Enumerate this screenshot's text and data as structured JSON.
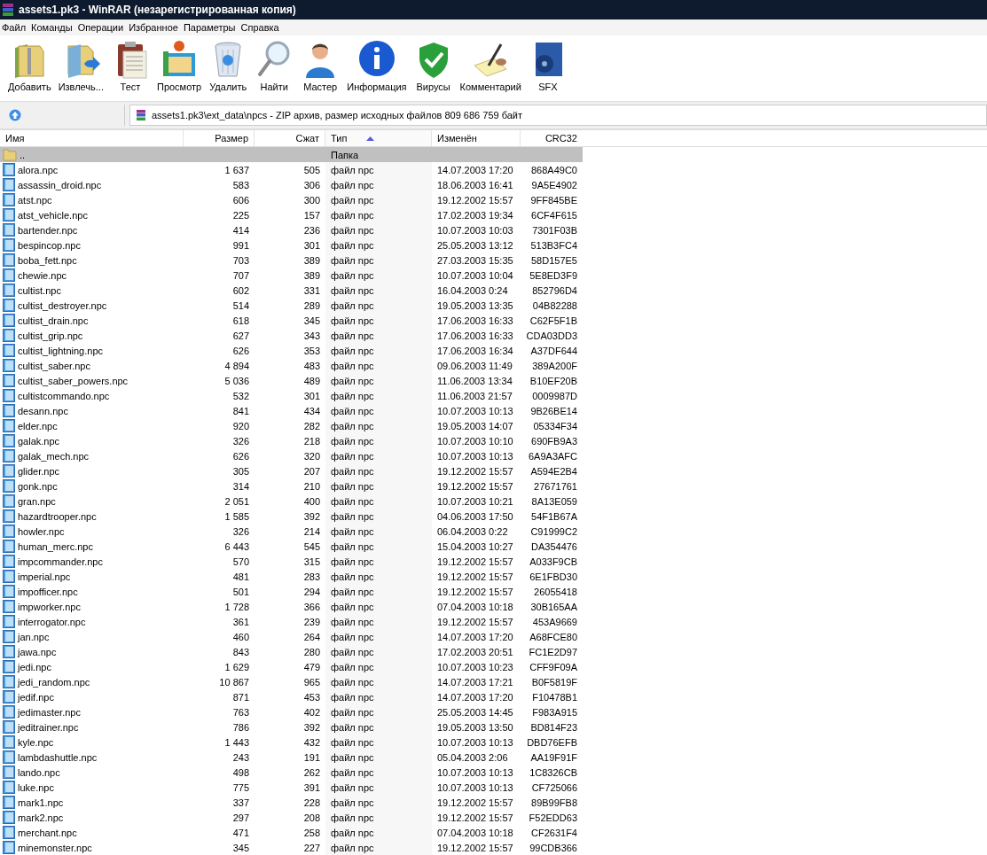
{
  "window": {
    "title": "assets1.pk3 - WinRAR (незарегистрированная копия)"
  },
  "menu": [
    "Файл",
    "Команды",
    "Операции",
    "Избранное",
    "Параметры",
    "Справка"
  ],
  "toolbar": [
    "Добавить",
    "Извлечь...",
    "Тест",
    "Просмотр",
    "Удалить",
    "Найти",
    "Мастер",
    "Информация",
    "Вирусы",
    "Комментарий",
    "SFX"
  ],
  "address": {
    "path": "assets1.pk3\\ext_data\\npcs - ZIP архив, размер исходных файлов 809 686 759 байт"
  },
  "table": {
    "columns": [
      {
        "label": "Имя",
        "sorted": false
      },
      {
        "label": "Размер",
        "sorted": false
      },
      {
        "label": "Сжат",
        "sorted": false
      },
      {
        "label": "Тип",
        "sorted": true
      },
      {
        "label": "Изменён",
        "sorted": false
      },
      {
        "label": "CRC32",
        "sorted": false
      }
    ],
    "rows": [
      {
        "kind": "parent",
        "selected": true,
        "cells": [
          "..",
          "",
          "",
          "Папка",
          "",
          ""
        ]
      },
      {
        "kind": "file",
        "selected": false,
        "cells": [
          "alora.npc",
          "1 637",
          "505",
          "файл npc",
          "14.07.2003 17:20",
          "868A49C0"
        ]
      },
      {
        "kind": "file",
        "selected": false,
        "cells": [
          "assassin_droid.npc",
          "583",
          "306",
          "файл npc",
          "18.06.2003 16:41",
          "9A5E4902"
        ]
      },
      {
        "kind": "file",
        "selected": false,
        "cells": [
          "atst.npc",
          "606",
          "300",
          "файл npc",
          "19.12.2002 15:57",
          "9FF845BE"
        ]
      },
      {
        "kind": "file",
        "selected": false,
        "cells": [
          "atst_vehicle.npc",
          "225",
          "157",
          "файл npc",
          "17.02.2003 19:34",
          "6CF4F615"
        ]
      },
      {
        "kind": "file",
        "selected": false,
        "cells": [
          "bartender.npc",
          "414",
          "236",
          "файл npc",
          "10.07.2003 10:03",
          "7301F03B"
        ]
      },
      {
        "kind": "file",
        "selected": false,
        "cells": [
          "bespincop.npc",
          "991",
          "301",
          "файл npc",
          "25.05.2003 13:12",
          "513B3FC4"
        ]
      },
      {
        "kind": "file",
        "selected": false,
        "cells": [
          "boba_fett.npc",
          "703",
          "389",
          "файл npc",
          "27.03.2003 15:35",
          "58D157E5"
        ]
      },
      {
        "kind": "file",
        "selected": false,
        "cells": [
          "chewie.npc",
          "707",
          "389",
          "файл npc",
          "10.07.2003 10:04",
          "5E8ED3F9"
        ]
      },
      {
        "kind": "file",
        "selected": false,
        "cells": [
          "cultist.npc",
          "602",
          "331",
          "файл npc",
          "16.04.2003 0:24",
          "852796D4"
        ]
      },
      {
        "kind": "file",
        "selected": false,
        "cells": [
          "cultist_destroyer.npc",
          "514",
          "289",
          "файл npc",
          "19.05.2003 13:35",
          "04B82288"
        ]
      },
      {
        "kind": "file",
        "selected": false,
        "cells": [
          "cultist_drain.npc",
          "618",
          "345",
          "файл npc",
          "17.06.2003 16:33",
          "C62F5F1B"
        ]
      },
      {
        "kind": "file",
        "selected": false,
        "cells": [
          "cultist_grip.npc",
          "627",
          "343",
          "файл npc",
          "17.06.2003 16:33",
          "CDA03DD3"
        ]
      },
      {
        "kind": "file",
        "selected": false,
        "cells": [
          "cultist_lightning.npc",
          "626",
          "353",
          "файл npc",
          "17.06.2003 16:34",
          "A37DF644"
        ]
      },
      {
        "kind": "file",
        "selected": false,
        "cells": [
          "cultist_saber.npc",
          "4 894",
          "483",
          "файл npc",
          "09.06.2003 11:49",
          "389A200F"
        ]
      },
      {
        "kind": "file",
        "selected": false,
        "cells": [
          "cultist_saber_powers.npc",
          "5 036",
          "489",
          "файл npc",
          "11.06.2003 13:34",
          "B10EF20B"
        ]
      },
      {
        "kind": "file",
        "selected": false,
        "cells": [
          "cultistcommando.npc",
          "532",
          "301",
          "файл npc",
          "11.06.2003 21:57",
          "0009987D"
        ]
      },
      {
        "kind": "file",
        "selected": false,
        "cells": [
          "desann.npc",
          "841",
          "434",
          "файл npc",
          "10.07.2003 10:13",
          "9B26BE14"
        ]
      },
      {
        "kind": "file",
        "selected": false,
        "cells": [
          "elder.npc",
          "920",
          "282",
          "файл npc",
          "19.05.2003 14:07",
          "05334F34"
        ]
      },
      {
        "kind": "file",
        "selected": false,
        "cells": [
          "galak.npc",
          "326",
          "218",
          "файл npc",
          "10.07.2003 10:10",
          "690FB9A3"
        ]
      },
      {
        "kind": "file",
        "selected": false,
        "cells": [
          "galak_mech.npc",
          "626",
          "320",
          "файл npc",
          "10.07.2003 10:13",
          "6A9A3AFC"
        ]
      },
      {
        "kind": "file",
        "selected": false,
        "cells": [
          "glider.npc",
          "305",
          "207",
          "файл npc",
          "19.12.2002 15:57",
          "A594E2B4"
        ]
      },
      {
        "kind": "file",
        "selected": false,
        "cells": [
          "gonk.npc",
          "314",
          "210",
          "файл npc",
          "19.12.2002 15:57",
          "27671761"
        ]
      },
      {
        "kind": "file",
        "selected": false,
        "cells": [
          "gran.npc",
          "2 051",
          "400",
          "файл npc",
          "10.07.2003 10:21",
          "8A13E059"
        ]
      },
      {
        "kind": "file",
        "selected": false,
        "cells": [
          "hazardtrooper.npc",
          "1 585",
          "392",
          "файл npc",
          "04.06.2003 17:50",
          "54F1B67A"
        ]
      },
      {
        "kind": "file",
        "selected": false,
        "cells": [
          "howler.npc",
          "326",
          "214",
          "файл npc",
          "06.04.2003 0:22",
          "C91999C2"
        ]
      },
      {
        "kind": "file",
        "selected": false,
        "cells": [
          "human_merc.npc",
          "6 443",
          "545",
          "файл npc",
          "15.04.2003 10:27",
          "DA354476"
        ]
      },
      {
        "kind": "file",
        "selected": false,
        "cells": [
          "impcommander.npc",
          "570",
          "315",
          "файл npc",
          "19.12.2002 15:57",
          "A033F9CB"
        ]
      },
      {
        "kind": "file",
        "selected": false,
        "cells": [
          "imperial.npc",
          "481",
          "283",
          "файл npc",
          "19.12.2002 15:57",
          "6E1FBD30"
        ]
      },
      {
        "kind": "file",
        "selected": false,
        "cells": [
          "impofficer.npc",
          "501",
          "294",
          "файл npc",
          "19.12.2002 15:57",
          "26055418"
        ]
      },
      {
        "kind": "file",
        "selected": false,
        "cells": [
          "impworker.npc",
          "1 728",
          "366",
          "файл npc",
          "07.04.2003 10:18",
          "30B165AA"
        ]
      },
      {
        "kind": "file",
        "selected": false,
        "cells": [
          "interrogator.npc",
          "361",
          "239",
          "файл npc",
          "19.12.2002 15:57",
          "453A9669"
        ]
      },
      {
        "kind": "file",
        "selected": false,
        "cells": [
          "jan.npc",
          "460",
          "264",
          "файл npc",
          "14.07.2003 17:20",
          "A68FCE80"
        ]
      },
      {
        "kind": "file",
        "selected": false,
        "cells": [
          "jawa.npc",
          "843",
          "280",
          "файл npc",
          "17.02.2003 20:51",
          "FC1E2D97"
        ]
      },
      {
        "kind": "file",
        "selected": false,
        "cells": [
          "jedi.npc",
          "1 629",
          "479",
          "файл npc",
          "10.07.2003 10:23",
          "CFF9F09A"
        ]
      },
      {
        "kind": "file",
        "selected": false,
        "cells": [
          "jedi_random.npc",
          "10 867",
          "965",
          "файл npc",
          "14.07.2003 17:21",
          "B0F5819F"
        ]
      },
      {
        "kind": "file",
        "selected": false,
        "cells": [
          "jedif.npc",
          "871",
          "453",
          "файл npc",
          "14.07.2003 17:20",
          "F10478B1"
        ]
      },
      {
        "kind": "file",
        "selected": false,
        "cells": [
          "jedimaster.npc",
          "763",
          "402",
          "файл npc",
          "25.05.2003 14:45",
          "F983A915"
        ]
      },
      {
        "kind": "file",
        "selected": false,
        "cells": [
          "jeditrainer.npc",
          "786",
          "392",
          "файл npc",
          "19.05.2003 13:50",
          "BD814F23"
        ]
      },
      {
        "kind": "file",
        "selected": false,
        "cells": [
          "kyle.npc",
          "1 443",
          "432",
          "файл npc",
          "10.07.2003 10:13",
          "DBD76EFB"
        ]
      },
      {
        "kind": "file",
        "selected": false,
        "cells": [
          "lambdashuttle.npc",
          "243",
          "191",
          "файл npc",
          "05.04.2003 2:06",
          "AA19F91F"
        ]
      },
      {
        "kind": "file",
        "selected": false,
        "cells": [
          "lando.npc",
          "498",
          "262",
          "файл npc",
          "10.07.2003 10:13",
          "1C8326CB"
        ]
      },
      {
        "kind": "file",
        "selected": false,
        "cells": [
          "luke.npc",
          "775",
          "391",
          "файл npc",
          "10.07.2003 10:13",
          "CF725066"
        ]
      },
      {
        "kind": "file",
        "selected": false,
        "cells": [
          "mark1.npc",
          "337",
          "228",
          "файл npc",
          "19.12.2002 15:57",
          "89B99FB8"
        ]
      },
      {
        "kind": "file",
        "selected": false,
        "cells": [
          "mark2.npc",
          "297",
          "208",
          "файл npc",
          "19.12.2002 15:57",
          "F52EDD63"
        ]
      },
      {
        "kind": "file",
        "selected": false,
        "cells": [
          "merchant.npc",
          "471",
          "258",
          "файл npc",
          "07.04.2003 10:18",
          "CF2631F4"
        ]
      },
      {
        "kind": "file",
        "selected": false,
        "cells": [
          "minemonster.npc",
          "345",
          "227",
          "файл npc",
          "19.12.2002 15:57",
          "99CDB366"
        ]
      }
    ]
  }
}
